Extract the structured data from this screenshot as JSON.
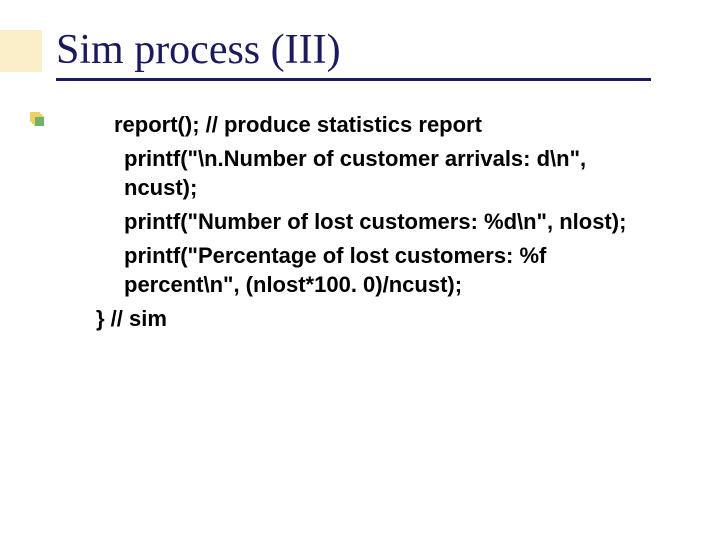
{
  "title": "Sim process (III)",
  "lines": {
    "l1": "report(); // produce statistics report",
    "l2": "printf(\"\\n.Number of customer arrivals: d\\n\", ncust);",
    "l3": "printf(\"Number of lost customers: %d\\n\", nlost);",
    "l4": "printf(\"Percentage of lost customers: %f percent\\n\", (nlost*100. 0)/ncust);",
    "l5": "} // sim"
  }
}
